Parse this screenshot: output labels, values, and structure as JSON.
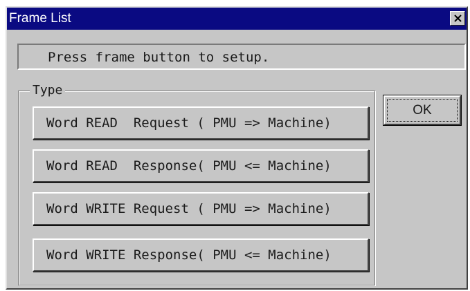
{
  "window": {
    "title": "Frame List",
    "close_icon": "close-icon"
  },
  "message": "Press frame button to setup.",
  "group": {
    "label": "Type",
    "buttons": [
      "Word READ  Request ( PMU => Machine)",
      "Word READ  Response( PMU <= Machine)",
      "Word WRITE Request ( PMU => Machine)",
      "Word WRITE Response( PMU <= Machine)"
    ]
  },
  "ok_label": "OK",
  "colors": {
    "titlebar": "#0a0a82",
    "face": "#c6c6c6"
  }
}
